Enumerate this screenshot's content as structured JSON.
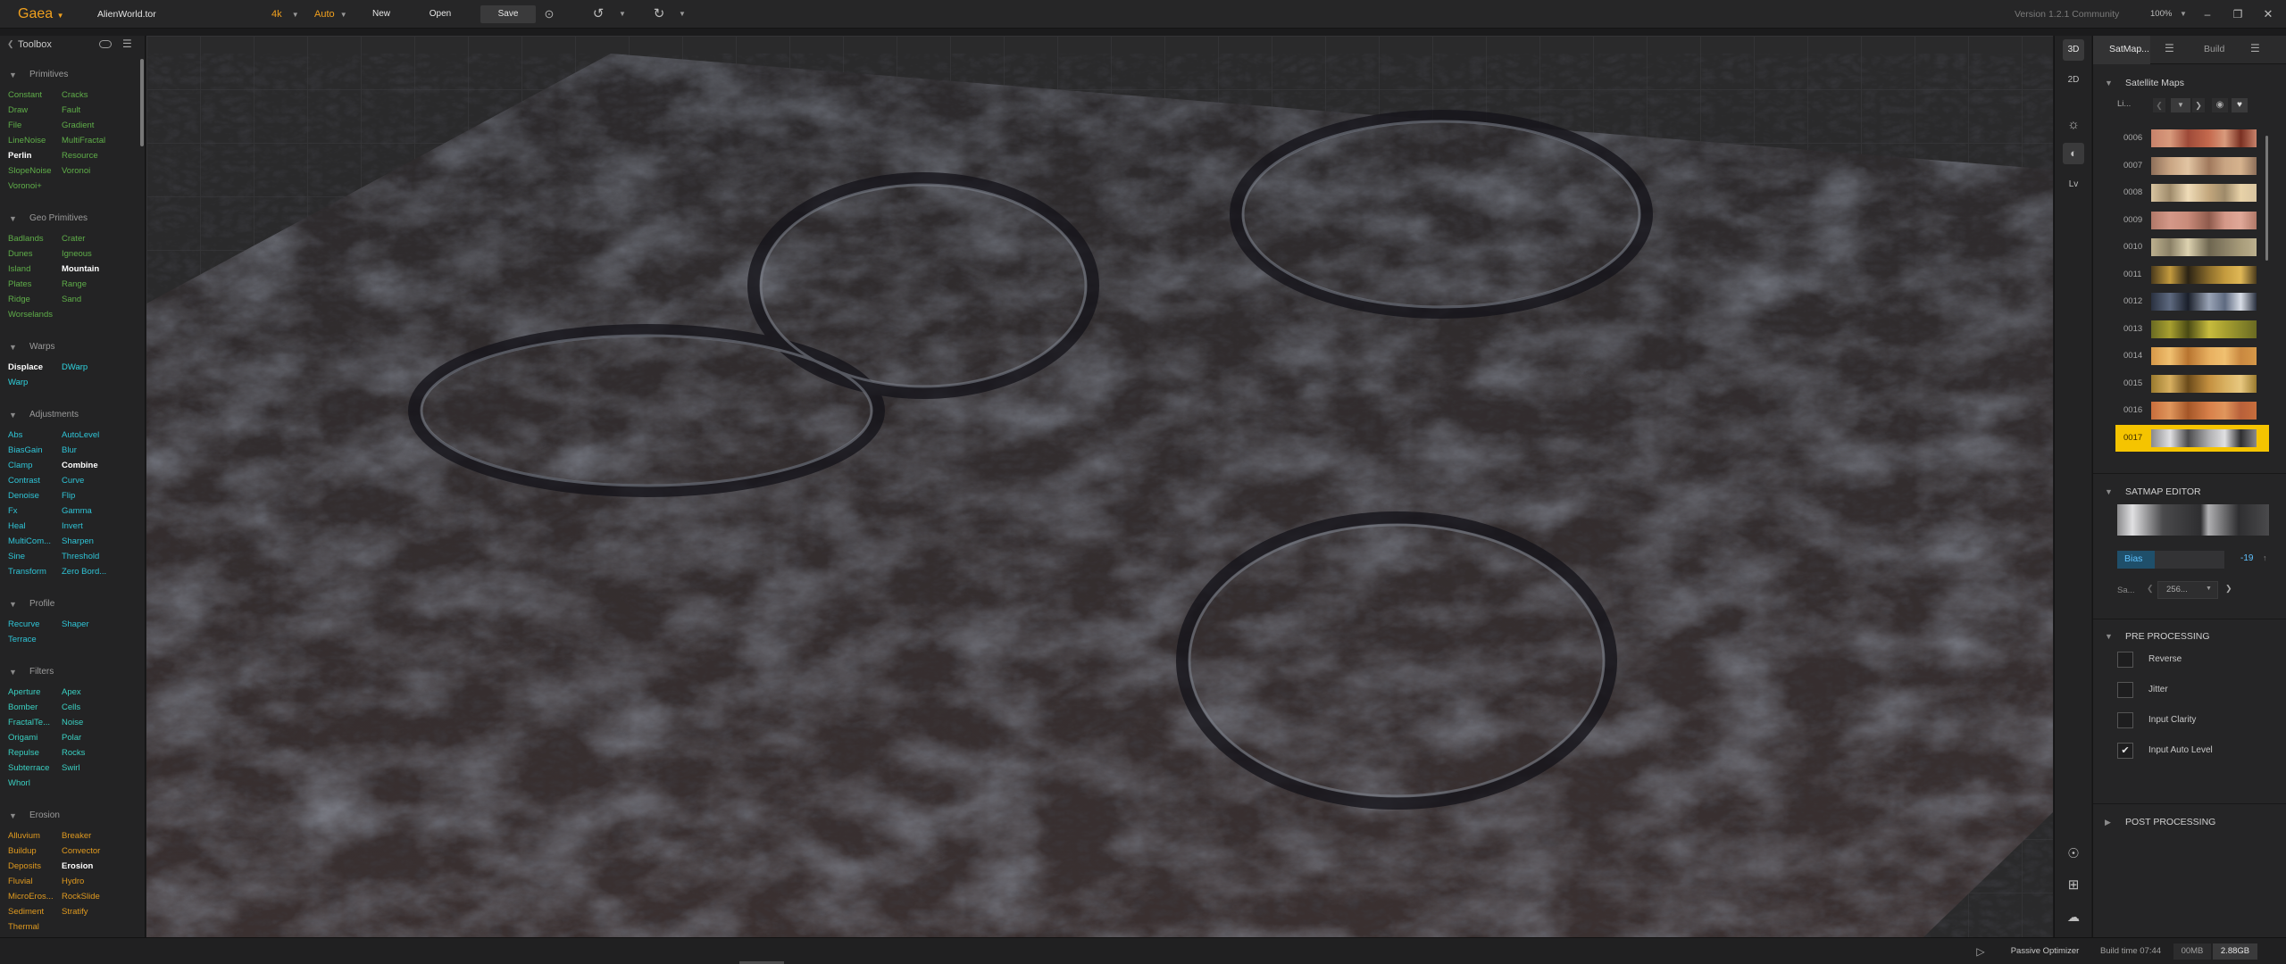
{
  "app": {
    "name": "Gaea",
    "file": "AlienWorld.tor",
    "version": "Version 1.2.1 Community",
    "zoom": "100%"
  },
  "toolbar": {
    "resolution": "4k",
    "build_mode": "Auto",
    "new_label": "New",
    "open_label": "Open",
    "save_label": "Save"
  },
  "colors": {
    "accent": "#f0a01e",
    "primitive_green": "#5fae49",
    "warp_cyan": "#2fd4e0",
    "erosion_orange": "#e09a1f",
    "selected_yellow": "#f5c400"
  },
  "toolbox": {
    "title": "Toolbox",
    "sections": [
      {
        "title": "Primitives",
        "color": "#5fae49",
        "col1": [
          "Constant",
          "Draw",
          "File",
          "LineNoise",
          "Perlin",
          "SlopeNoise",
          "Voronoi+"
        ],
        "col2": [
          "Cracks",
          "Fault",
          "Gradient",
          "MultiFractal",
          "Resource",
          "Voronoi"
        ],
        "bold": [
          "Perlin"
        ]
      },
      {
        "title": "Geo Primitives",
        "color": "#5fae49",
        "col1": [
          "Badlands",
          "Dunes",
          "Island",
          "Plates",
          "Ridge",
          "Worselands"
        ],
        "col2": [
          "Crater",
          "Igneous",
          "Mountain",
          "Range",
          "Sand"
        ],
        "bold": [
          "Mountain"
        ]
      },
      {
        "title": "Warps",
        "color": "#2fd4e0",
        "col1": [
          "Displace",
          "Warp"
        ],
        "col2": [
          "DWarp"
        ],
        "bold": [
          "Displace"
        ]
      },
      {
        "title": "Adjustments",
        "color": "#2fc4d6",
        "col1": [
          "Abs",
          "BiasGain",
          "Clamp",
          "Contrast",
          "Denoise",
          "Fx",
          "Heal",
          "MultiCom...",
          "Sine",
          "Transform"
        ],
        "col2": [
          "AutoLevel",
          "Blur",
          "Combine",
          "Curve",
          "Flip",
          "Gamma",
          "Invert",
          "Sharpen",
          "Threshold",
          "Zero Bord..."
        ],
        "bold": [
          "Combine"
        ]
      },
      {
        "title": "Profile",
        "color": "#2fc4d6",
        "col1": [
          "Recurve",
          "Terrace"
        ],
        "col2": [
          "Shaper"
        ],
        "bold": []
      },
      {
        "title": "Filters",
        "color": "#3ad0c2",
        "col1": [
          "Aperture",
          "Bomber",
          "FractalTe...",
          "Origami",
          "Repulse",
          "Subterrace",
          "Whorl"
        ],
        "col2": [
          "Apex",
          "Cells",
          "Noise",
          "Polar",
          "Rocks",
          "Swirl"
        ],
        "bold": []
      },
      {
        "title": "Erosion",
        "color": "#e09a1f",
        "col1": [
          "Alluvium",
          "Buildup",
          "Deposits",
          "Fluvial",
          "MicroEros...",
          "Sediment",
          "Thermal"
        ],
        "col2": [
          "Breaker",
          "Convector",
          "Erosion",
          "Hydro",
          "RockSlide",
          "Stratify"
        ],
        "bold": [
          "Erosion"
        ]
      }
    ]
  },
  "viewport_strip": {
    "btn_3d": "3D",
    "btn_2d": "2D",
    "btn_lv": "Lv"
  },
  "right_panel": {
    "tab_satmaps": "SatMap...",
    "tab_build": "Build",
    "satellite_maps_title": "Satellite Maps",
    "library_label": "Li...",
    "satmaps": [
      {
        "id": "0006",
        "colors": [
          "#c8826a",
          "#d89a7c",
          "#9e4a38",
          "#c56a4e",
          "#7a3022"
        ]
      },
      {
        "id": "0007",
        "colors": [
          "#8e6f59",
          "#c9a583",
          "#e2c5a3",
          "#a0785c",
          "#d6b38e"
        ]
      },
      {
        "id": "0008",
        "colors": [
          "#d8c4a0",
          "#9e8a6a",
          "#efdcb8",
          "#c2a67c",
          "#e8d2a8"
        ]
      },
      {
        "id": "0009",
        "colors": [
          "#b07868",
          "#d49888",
          "#c98b7a",
          "#8e5a4c",
          "#e0a898"
        ]
      },
      {
        "id": "0010",
        "colors": [
          "#bcb08e",
          "#8a8066",
          "#ddd2b0",
          "#6e6650",
          "#a89c7a"
        ]
      },
      {
        "id": "0011",
        "colors": [
          "#4a3a1c",
          "#c49b3e",
          "#2a2214",
          "#8d6e2c",
          "#e0b856"
        ]
      },
      {
        "id": "0012",
        "colors": [
          "#2a3140",
          "#5e6a80",
          "#1a1f2a",
          "#9aa4b6",
          "#d8dde6"
        ]
      },
      {
        "id": "0013",
        "colors": [
          "#6a6a22",
          "#a8a030",
          "#4a4a14",
          "#c8bc3e",
          "#88862a"
        ]
      },
      {
        "id": "0014",
        "colors": [
          "#d69848",
          "#f0c070",
          "#b87430",
          "#e8b060",
          "#c98840"
        ]
      },
      {
        "id": "0015",
        "colors": [
          "#9a7a2e",
          "#d8b060",
          "#6a4a1a",
          "#c49040",
          "#e8c880"
        ]
      },
      {
        "id": "0016",
        "colors": [
          "#c86e3c",
          "#e0965c",
          "#a45628",
          "#d8804a",
          "#b8603a"
        ]
      },
      {
        "id": "0017",
        "colors": [
          "#8a8a8c",
          "#e0e0e2",
          "#4a4a4c",
          "#b0b0b2",
          "#2e2e30"
        ]
      }
    ],
    "selected_satmap": "0017",
    "satmap_editor_title": "SATMAP EDITOR",
    "bias_label": "Bias",
    "bias_value": "-19",
    "bias_fraction": 0.35,
    "sample_label": "Sa...",
    "sample_value": "256...",
    "pre_processing_title": "PRE PROCESSING",
    "options": [
      {
        "label": "Reverse",
        "checked": false
      },
      {
        "label": "Jitter",
        "checked": false
      },
      {
        "label": "Input Clarity",
        "checked": false
      },
      {
        "label": "Input Auto Level",
        "checked": true
      }
    ],
    "post_processing_title": "POST PROCESSING"
  },
  "status": {
    "passive_optimizer": "Passive Optimizer",
    "build_time": "Build time 07:44",
    "memory_a": "00MB",
    "memory_b": "2.88GB"
  }
}
